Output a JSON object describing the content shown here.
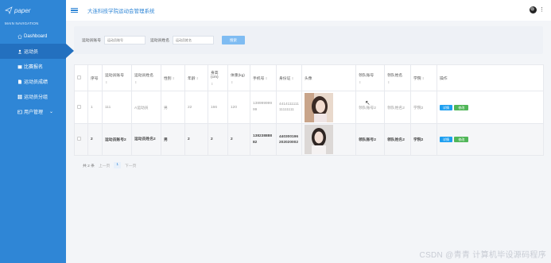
{
  "sidebar": {
    "logo_text": "paper",
    "section_label": "MAIN NAVIGATION",
    "items": [
      {
        "label": "Dashboard",
        "icon": "home-icon"
      },
      {
        "label": "运动员",
        "icon": "user-icon"
      },
      {
        "label": "比赛报名",
        "icon": "calendar-icon"
      },
      {
        "label": "运动员成绩",
        "icon": "file-icon"
      },
      {
        "label": "运动员分组",
        "icon": "grid-icon"
      },
      {
        "label": "用户管理",
        "icon": "users-icon"
      }
    ]
  },
  "header": {
    "title": "大连科技学院运动会管理系统"
  },
  "search": {
    "label1": "运动员账号",
    "placeholder1": "运动员账号",
    "label2": "运动员姓名",
    "placeholder2": "运动员姓名",
    "button": "搜索"
  },
  "table": {
    "headers": [
      "序号",
      "运动员账号",
      "运动员姓名",
      "性别",
      "年龄",
      "身高(cm)",
      "体重(kg)",
      "手机号",
      "身份证",
      "头像",
      "领队账号",
      "领队姓名",
      "学院",
      "操作"
    ],
    "sort_sub": "0",
    "rows": [
      {
        "no": "1",
        "account": "111",
        "name": "A运动员",
        "gender": "男",
        "age": "22",
        "height": "166",
        "weight": "120",
        "phone": "13899999999",
        "id_card": "441411111111111111",
        "leader_account": "领队账号2",
        "leader_name": "领队姓名2",
        "college": "学院2"
      },
      {
        "no": "2",
        "account": "运动员账号2",
        "name": "运动员姓名2",
        "gender": "男",
        "age": "2",
        "height": "2",
        "weight": "2",
        "phone": "13823888882",
        "id_card": "440300196202020002",
        "leader_account": "领队账号2",
        "leader_name": "领队姓名2",
        "college": "学院2"
      }
    ],
    "actions": {
      "detail": "详情",
      "edit": "修改"
    }
  },
  "pager": {
    "total": "共 2 条",
    "prev": "上一页",
    "current": "1",
    "next": "下一页"
  },
  "watermark": "CSDN @青青  计算机毕设源码程序"
}
